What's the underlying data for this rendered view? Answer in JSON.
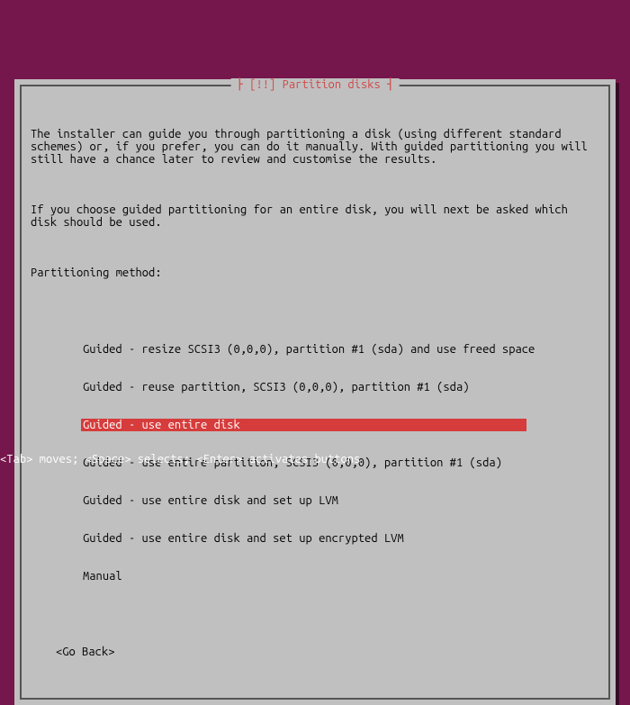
{
  "dialog": {
    "title": "[!!] Partition disks",
    "paragraphs": [
      "The installer can guide you through partitioning a disk (using different standard schemes) or, if you prefer, you can do it manually. With guided partitioning you will still have a chance later to review and customise the results.",
      "If you choose guided partitioning for an entire disk, you will next be asked which disk should be used.",
      "Partitioning method:"
    ],
    "options": [
      "Guided - resize SCSI3 (0,0,0), partition #1 (sda) and use freed space",
      "Guided - reuse partition, SCSI3 (0,0,0), partition #1 (sda)",
      "Guided - use entire disk",
      "Guided - use entire partition, SCSI3 (0,0,0), partition #1 (sda)",
      "Guided - use entire disk and set up LVM",
      "Guided - use entire disk and set up encrypted LVM",
      "Manual"
    ],
    "selected_index": 2,
    "go_back": "<Go Back>"
  },
  "status_bar": "<Tab> moves; <Space> selects; <Enter> activates buttons"
}
